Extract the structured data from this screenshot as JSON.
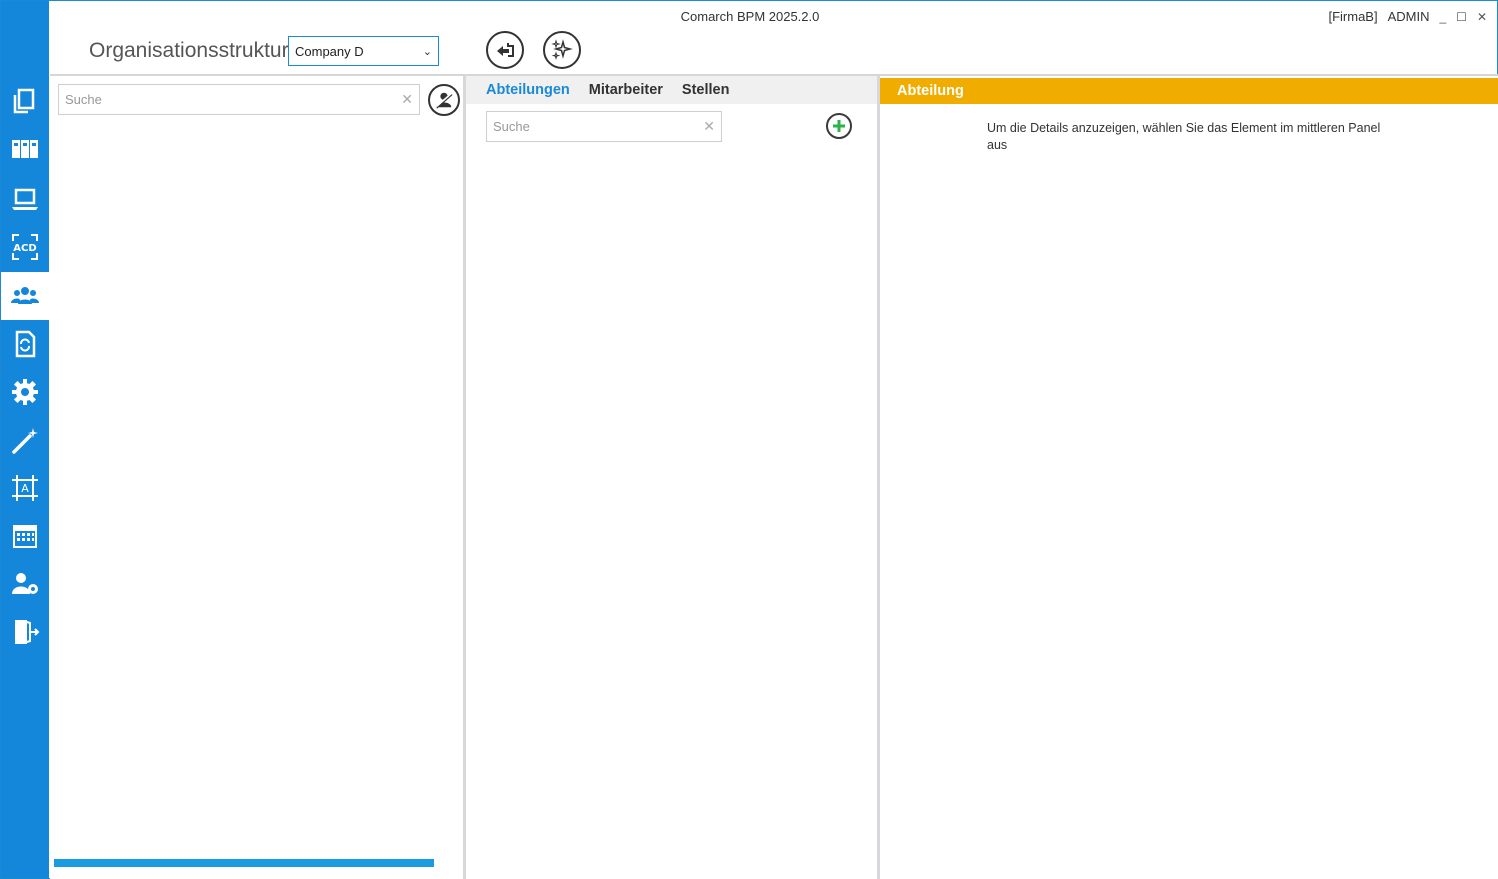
{
  "window": {
    "title": "Comarch BPM 2025.2.0",
    "company_tag": "[FirmaB]",
    "user": "ADMIN",
    "minimize": "_",
    "maximize": "☐",
    "close": "✕"
  },
  "header": {
    "title": "Organisationsstruktur",
    "company_select_value": "Company D",
    "back_button_icon": "back-arrow-icon",
    "magic_button_icon": "sparkles-icon"
  },
  "sidebar": {
    "items": [
      {
        "icon": "documents-icon"
      },
      {
        "icon": "binders-icon"
      },
      {
        "icon": "laptop-icon"
      },
      {
        "icon": "acd-icon",
        "label": "ACD"
      },
      {
        "icon": "users-group-icon",
        "active": true
      },
      {
        "icon": "document-refresh-icon"
      },
      {
        "icon": "gear-icon"
      },
      {
        "icon": "magic-wand-icon"
      },
      {
        "icon": "designer-icon",
        "label": "A"
      },
      {
        "icon": "calendar-icon"
      },
      {
        "icon": "user-settings-icon"
      },
      {
        "icon": "exit-icon"
      }
    ]
  },
  "left_panel": {
    "search_placeholder": "Suche",
    "clear": "✕",
    "progress": 1.0
  },
  "middle_panel": {
    "tabs": [
      {
        "label": "Abteilungen",
        "active": true
      },
      {
        "label": "Mitarbeiter"
      },
      {
        "label": "Stellen"
      }
    ],
    "search_placeholder": "Suche",
    "clear": "✕"
  },
  "right_panel": {
    "header": "Abteilung",
    "hint": "Um die Details anzuzeigen, wählen Sie das Element im mittleren Panel aus"
  },
  "colors": {
    "sidebar": "#1487da",
    "accent": "#1b8ad6",
    "detail_header": "#f0ad00",
    "add_green": "#2bb34a"
  }
}
